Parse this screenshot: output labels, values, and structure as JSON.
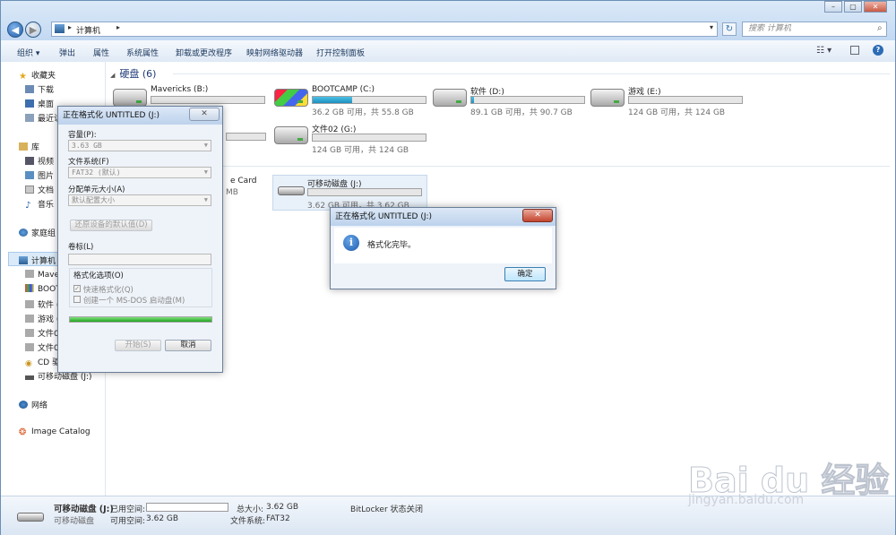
{
  "explorer": {
    "address": {
      "segments": [
        "计算机"
      ]
    },
    "search_placeholder": "搜索 计算机",
    "toolbar": [
      "组织 ▾",
      "弹出",
      "属性",
      "系统属性",
      "卸载或更改程序",
      "映射网络驱动器",
      "打开控制面板"
    ],
    "sidebar": {
      "favorites": {
        "label": "收藏夹",
        "items": [
          "下载",
          "桌面",
          "最近访"
        ]
      },
      "library": {
        "label": "库",
        "items": [
          "视频",
          "图片",
          "文档",
          "音乐"
        ]
      },
      "homegroup": "家庭组",
      "computer": {
        "label": "计算机",
        "items": [
          "Mave",
          "BOOT",
          "软件 (",
          "游戏 (",
          "文件0",
          "文件0",
          "CD 驱",
          "可移动磁盘 (J:)"
        ]
      },
      "network": "网络",
      "image_catalog": "Image Catalog"
    },
    "group_hdd": "硬盘 (6)",
    "drives": [
      {
        "name": "Mavericks (B:)",
        "info": "",
        "fill": 0.0
      },
      {
        "name": "BOOTCAMP (C:)",
        "info": "36.2 GB 可用，共 55.8 GB",
        "fill": 0.35
      },
      {
        "name": "软件 (D:)",
        "info": "89.1 GB 可用，共 90.7 GB",
        "fill": 0.02
      },
      {
        "name": "游戏 (E:)",
        "info": "124 GB 可用，共 124 GB",
        "fill": 0.0
      },
      {
        "name": "文件02 (G:)",
        "info": "124 GB 可用，共 124 GB",
        "fill": 0.0
      }
    ],
    "card_fragment": "e Card",
    "card_fragment2": "MB",
    "removable": {
      "name": "可移动磁盘 (J:)",
      "info": "3.62 GB 可用，共 3.62 GB"
    },
    "status": {
      "name": "可移动磁盘 (J:)",
      "type": "可移动磁盘",
      "used_label": "已用空间:",
      "free_label": "可用空间:",
      "free_value": "3.62 GB",
      "total_label": "总大小:",
      "total_value": "3.62 GB",
      "fs_label": "文件系统:",
      "fs_value": "FAT32",
      "bitlocker_label": "BitLocker 状态:",
      "bitlocker_value": "关闭"
    }
  },
  "format_dialog": {
    "title": "正在格式化 UNTITLED (J:)",
    "capacity_label": "容量(P):",
    "capacity_value": "3.63 GB",
    "fs_label": "文件系统(F)",
    "fs_value": "FAT32 (默认)",
    "alloc_label": "分配单元大小(A)",
    "alloc_value": "默认配置大小",
    "restore_label": "还原设备的默认值(D)",
    "volume_label": "卷标(L)",
    "volume_value": "",
    "options_label": "格式化选项(O)",
    "quick_label": "快速格式化(Q)",
    "msdos_label": "创建一个 MS-DOS 启动盘(M)",
    "progress": 1.0,
    "start_label": "开始(S)",
    "cancel_label": "取消"
  },
  "done_dialog": {
    "title": "正在格式化 UNTITLED (J:)",
    "message": "格式化完毕。",
    "ok_label": "确定"
  },
  "watermark": {
    "brand": "Bai du 经验",
    "url": "jingyan.baidu.com"
  }
}
